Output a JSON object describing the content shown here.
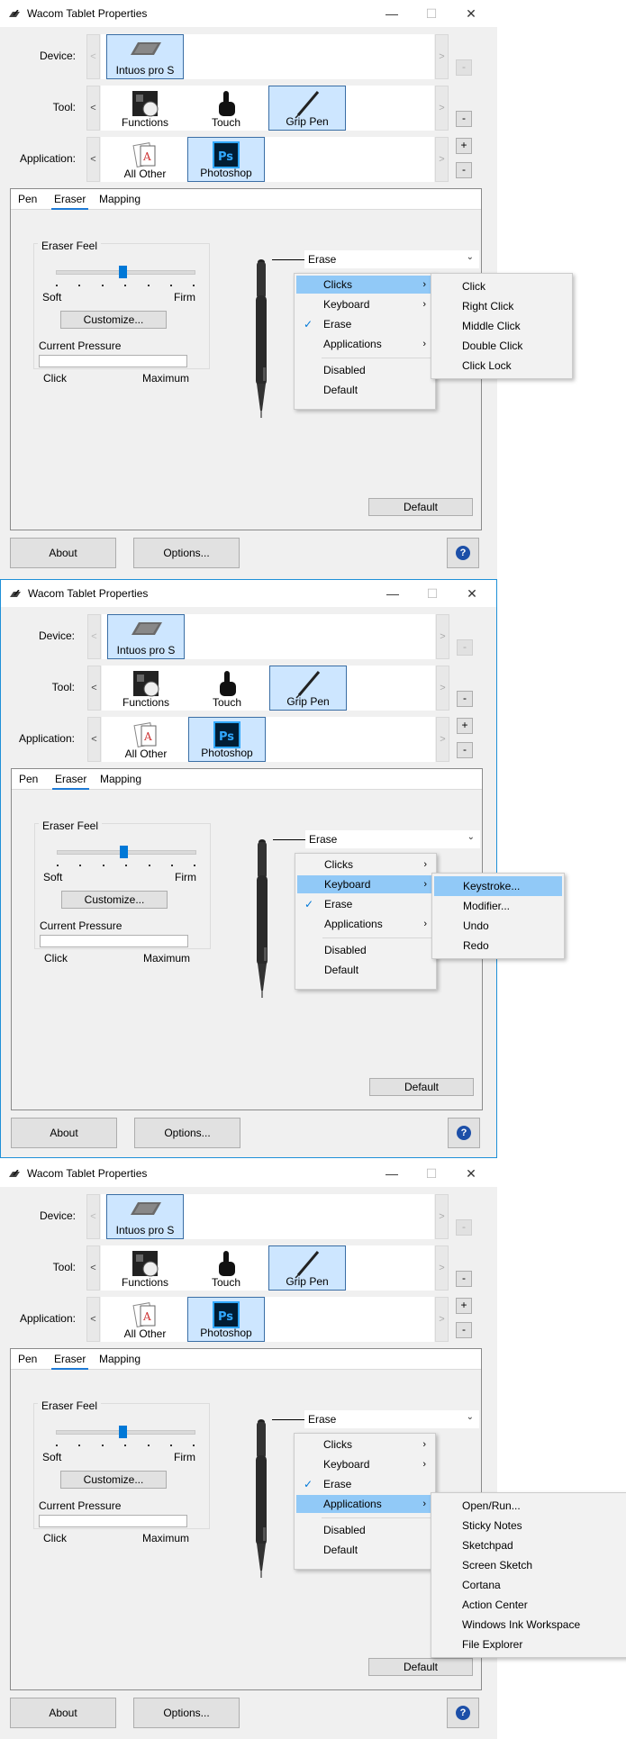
{
  "window": {
    "title": "Wacom Tablet Properties",
    "minimize": "—",
    "maximize": "☐",
    "close": "✕"
  },
  "rows": {
    "device_label": "Device:",
    "tool_label": "Tool:",
    "application_label": "Application:"
  },
  "nav": {
    "prev": "<",
    "next": ">",
    "remove": "-",
    "add": "+"
  },
  "device": {
    "name": "Intuos pro S"
  },
  "tools": [
    "Functions",
    "Touch",
    "Grip Pen"
  ],
  "applications": [
    "All Other",
    "Photoshop"
  ],
  "tabs": [
    "Pen",
    "Eraser",
    "Mapping"
  ],
  "eraser_feel": {
    "title": "Eraser Feel",
    "soft": "Soft",
    "firm": "Firm",
    "customize": "Customize...",
    "current_pressure": "Current Pressure",
    "click": "Click",
    "maximum": "Maximum",
    "level": 0.5
  },
  "eraser_dropdown": {
    "value": "Erase"
  },
  "menu": {
    "items": [
      "Clicks",
      "Keyboard",
      "Erase",
      "Applications",
      "Disabled",
      "Default"
    ]
  },
  "submenus": {
    "clicks": [
      "Click",
      "Right Click",
      "Middle Click",
      "Double Click",
      "Click Lock"
    ],
    "keyboard": [
      "Keystroke...",
      "Modifier...",
      "Undo",
      "Redo"
    ],
    "applications": [
      "Open/Run...",
      "Sticky Notes",
      "Sketchpad",
      "Screen Sketch",
      "Cortana",
      "Action Center",
      "Windows Ink Workspace",
      "File Explorer"
    ]
  },
  "buttons": {
    "default": "Default",
    "about": "About",
    "options": "Options...",
    "help": "?"
  }
}
